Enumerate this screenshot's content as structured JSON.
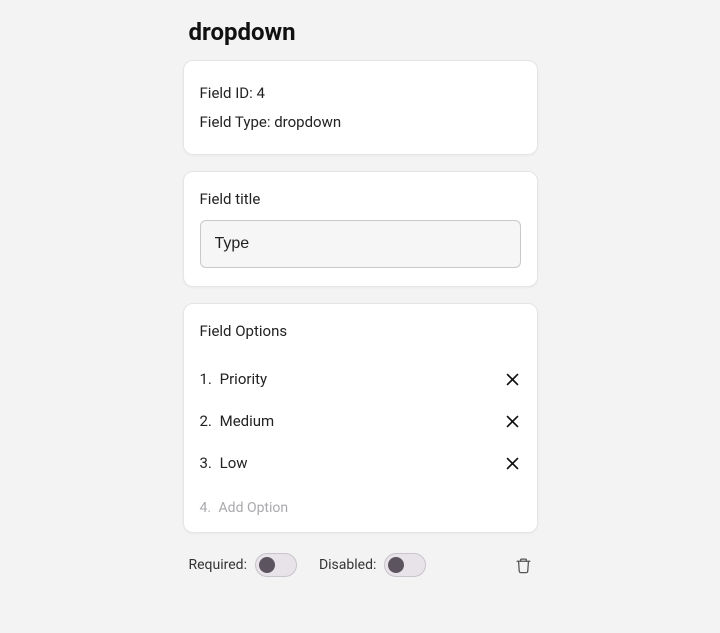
{
  "title": "dropdown",
  "info": {
    "field_id_label": "Field ID:",
    "field_id_value": "4",
    "field_type_label": "Field Type:",
    "field_type_value": "dropdown"
  },
  "field_title": {
    "label": "Field title",
    "value": "Type"
  },
  "options": {
    "label": "Field Options",
    "items": [
      {
        "num": "1.",
        "label": "Priority"
      },
      {
        "num": "2.",
        "label": "Medium"
      },
      {
        "num": "3.",
        "label": "Low"
      }
    ],
    "add_num": "4.",
    "add_label": "Add Option"
  },
  "footer": {
    "required_label": "Required:",
    "disabled_label": "Disabled:",
    "required_on": false,
    "disabled_on": false
  }
}
